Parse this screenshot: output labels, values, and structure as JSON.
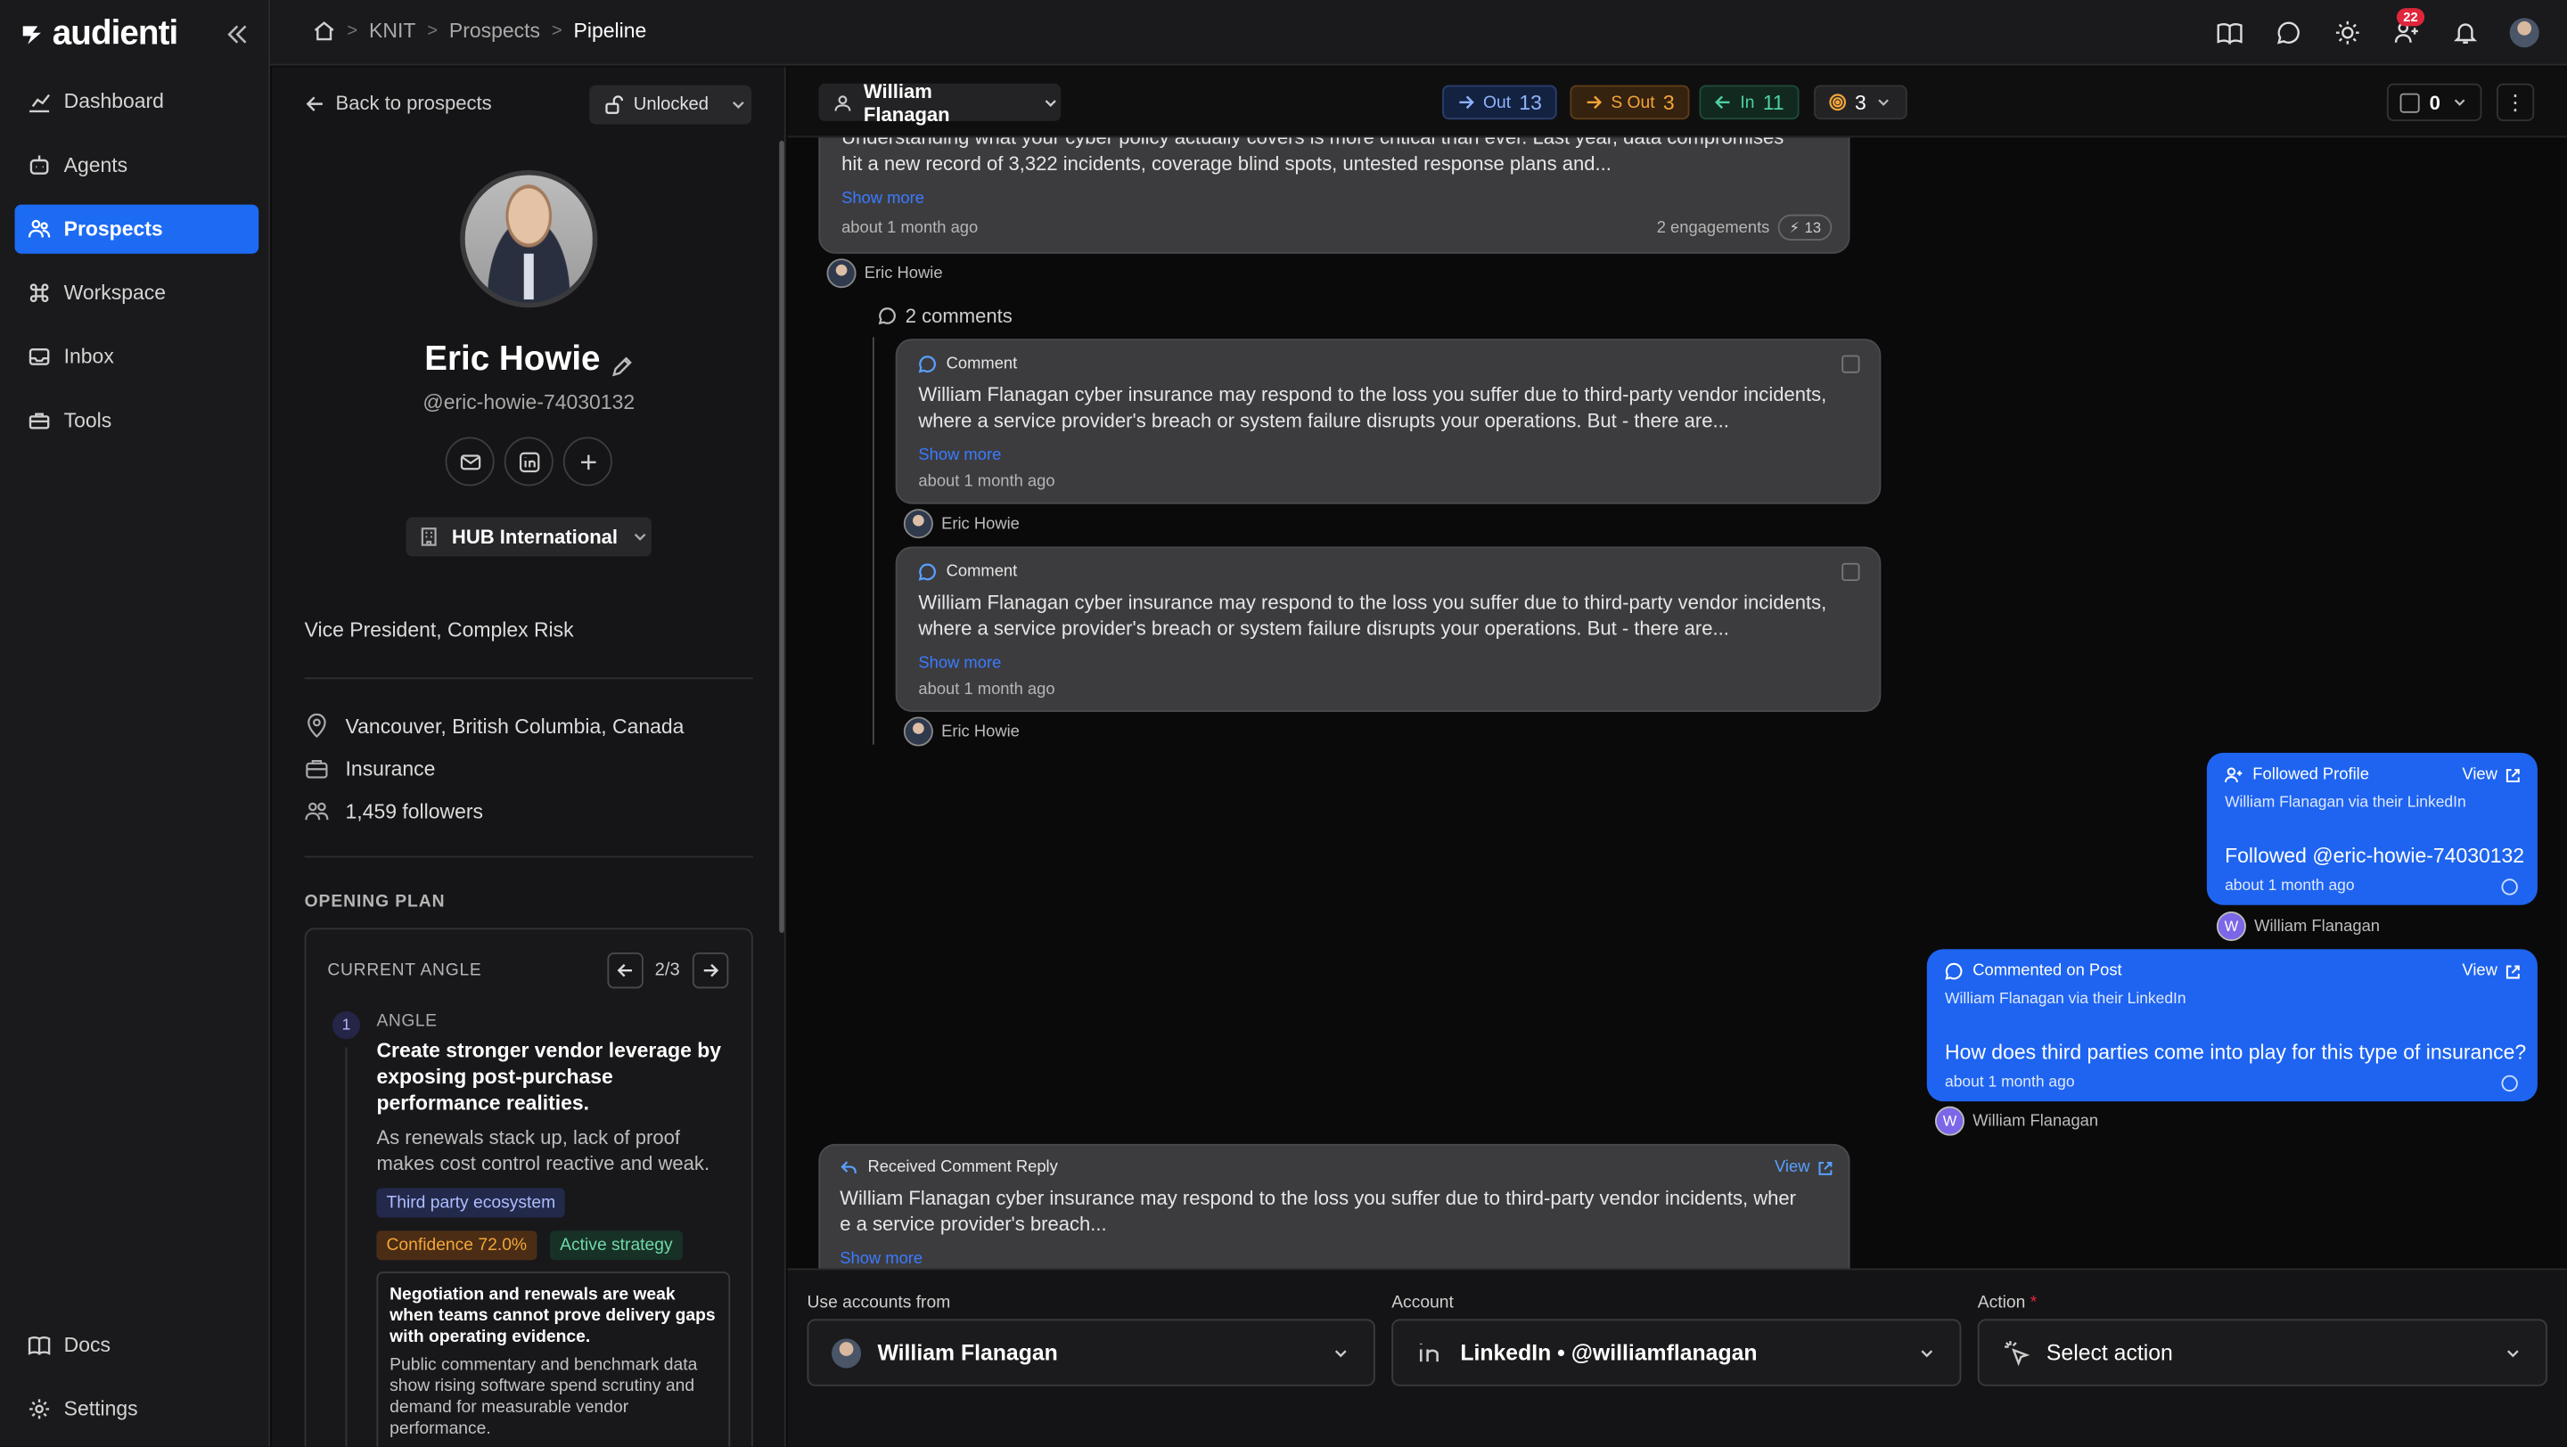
{
  "app": {
    "logo_text": "audienti"
  },
  "nav": {
    "items": [
      {
        "label": "Dashboard",
        "icon": "chart-icon"
      },
      {
        "label": "Agents",
        "icon": "robot-icon"
      },
      {
        "label": "Prospects",
        "icon": "users-icon",
        "active": true
      },
      {
        "label": "Workspace",
        "icon": "command-icon"
      },
      {
        "label": "Inbox",
        "icon": "inbox-icon"
      },
      {
        "label": "Tools",
        "icon": "toolbox-icon"
      }
    ],
    "bottom": [
      {
        "label": "Docs",
        "icon": "book-icon"
      },
      {
        "label": "Settings",
        "icon": "gear-icon"
      }
    ]
  },
  "breadcrumb": {
    "items": [
      "KNIT",
      "Prospects",
      "Pipeline"
    ]
  },
  "topbar": {
    "notification_count": "22"
  },
  "profile": {
    "back_label": "Back to prospects",
    "lock_status": "Unlocked",
    "name": "Eric Howie",
    "handle": "@eric-howie-74030132",
    "company": "HUB International",
    "title": "Vice President, Complex Risk",
    "location": "Vancouver, British Columbia, Canada",
    "industry": "Insurance",
    "followers": "1,459 followers",
    "opening_plan_heading": "OPENING PLAN",
    "plan": {
      "current_angle_label": "CURRENT ANGLE",
      "pager": "2/3",
      "step_number": "1",
      "angle_label": "ANGLE",
      "angle_title": "Create stronger vendor leverage by exposing post-purchase performance realities.",
      "angle_desc": "As renewals stack up, lack of proof makes cost control reactive and weak.",
      "tag_ecosystem": "Third party ecosystem",
      "tag_confidence": "Confidence 72.0%",
      "tag_strategy": "Active strategy",
      "evidence_title": "Negotiation and renewals are weak when teams cannot prove delivery gaps with operating evidence.",
      "evidence_body": "Public commentary and benchmark data show rising software spend scrutiny and demand for measurable vendor performance."
    }
  },
  "feed_header": {
    "user": "William Flanagan",
    "out_label": "Out",
    "out_count": "13",
    "sout_label": "S Out",
    "sout_count": "3",
    "in_label": "In",
    "in_count": "11",
    "target_count": "3",
    "selected_count": "0"
  },
  "feed": {
    "post": {
      "text_line1": "Understanding what your cyber policy actually covers is more critical than ever. Last year, data compromises",
      "text_line2": "hit a new record of 3,322 incidents, coverage blind spots, untested response plans and...",
      "show_more": "Show more",
      "time": "about 1 month ago",
      "engagements": "2 engagements",
      "engagement_score": "13",
      "author": "Eric Howie"
    },
    "comments_header": "2 comments",
    "comments": [
      {
        "type": "Comment",
        "line1": "William Flanagan cyber insurance may respond to the loss you suffer due to third-party vendor incidents,",
        "line2": "where a service provider's breach or system failure disrupts your operations. But - there are...",
        "show_more": "Show more",
        "time": "about 1 month ago",
        "author": "Eric Howie"
      },
      {
        "type": "Comment",
        "line1": "William Flanagan cyber insurance may respond to the loss you suffer due to third-party vendor incidents,",
        "line2": "where a service provider's breach or system failure disrupts your operations. But - there are...",
        "show_more": "Show more",
        "time": "about 1 month ago",
        "author": "Eric Howie"
      }
    ],
    "followed": {
      "type": "Followed Profile",
      "view": "View",
      "via": "William Flanagan via their LinkedIn",
      "message": "Followed @eric-howie-74030132",
      "time": "about 1 month ago",
      "author": "William Flanagan",
      "author_initial": "W"
    },
    "commented": {
      "type": "Commented on Post",
      "view": "View",
      "via": "William Flanagan via their LinkedIn",
      "message": "How does third parties come into play for this type of insurance?",
      "time": "about 1 month ago",
      "author": "William Flanagan",
      "author_initial": "W"
    },
    "reply": {
      "type": "Received Comment Reply",
      "view": "View",
      "line1": "William Flanagan cyber insurance may respond to the loss you suffer due to third-party vendor incidents, wher",
      "line2": "e a service provider's breach...",
      "show_more": "Show more"
    }
  },
  "composer": {
    "accounts_label": "Use accounts from",
    "accounts_value": "William Flanagan",
    "account_label": "Account",
    "account_value": "LinkedIn • @williamflanagan",
    "action_label": "Action",
    "action_required": "*",
    "action_placeholder": "Select action"
  },
  "colors": {
    "accent": "#1d6bf3",
    "card_bg": "#3c3c3f",
    "out": "#6ea0ff",
    "sout": "#f5a53a",
    "in": "#4fd1a5"
  }
}
